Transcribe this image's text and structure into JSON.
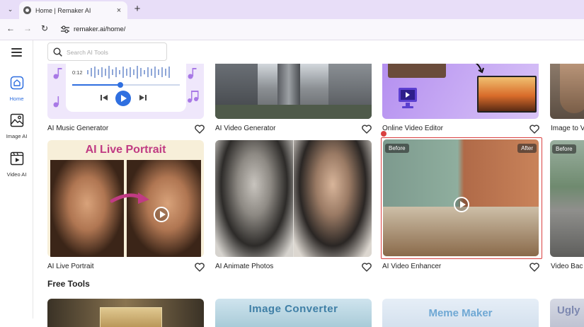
{
  "browser": {
    "tab_title": "Home | Remaker AI",
    "tab_close": "×",
    "new_tab": "+",
    "tab_menu": "⌄",
    "url": "remaker.ai/home/",
    "back": "←",
    "forward": "→",
    "reload": "↻"
  },
  "sidebar": {
    "items": [
      {
        "label": "Home",
        "active": true
      },
      {
        "label": "Image AI"
      },
      {
        "label": "Video AI"
      }
    ]
  },
  "search": {
    "placeholder": "Search AI Tools",
    "value": ""
  },
  "tools_row1": [
    {
      "label": "AI Music Generator",
      "player_time": "0:12"
    },
    {
      "label": "AI Video Generator"
    },
    {
      "label": "Online Video Editor"
    },
    {
      "label": "Image to V"
    }
  ],
  "tools_row2": [
    {
      "label": "AI Live Portrait",
      "banner": "AI Live Portrait"
    },
    {
      "label": "AI Animate Photos"
    },
    {
      "label": "AI Video Enhancer",
      "before": "Before",
      "after": "After"
    },
    {
      "label": "Video Bac",
      "before": "Before"
    }
  ],
  "free_tools": {
    "title": "Free Tools",
    "items": [
      {
        "banner": ""
      },
      {
        "banner": "Image Converter"
      },
      {
        "banner": "Meme Maker"
      },
      {
        "banner": "Ugly"
      }
    ]
  },
  "colors": {
    "accent": "#2f6fe0",
    "brand_pink": "#c03b83",
    "tab_bar": "#e8def8",
    "highlight_border": "#d94040"
  }
}
